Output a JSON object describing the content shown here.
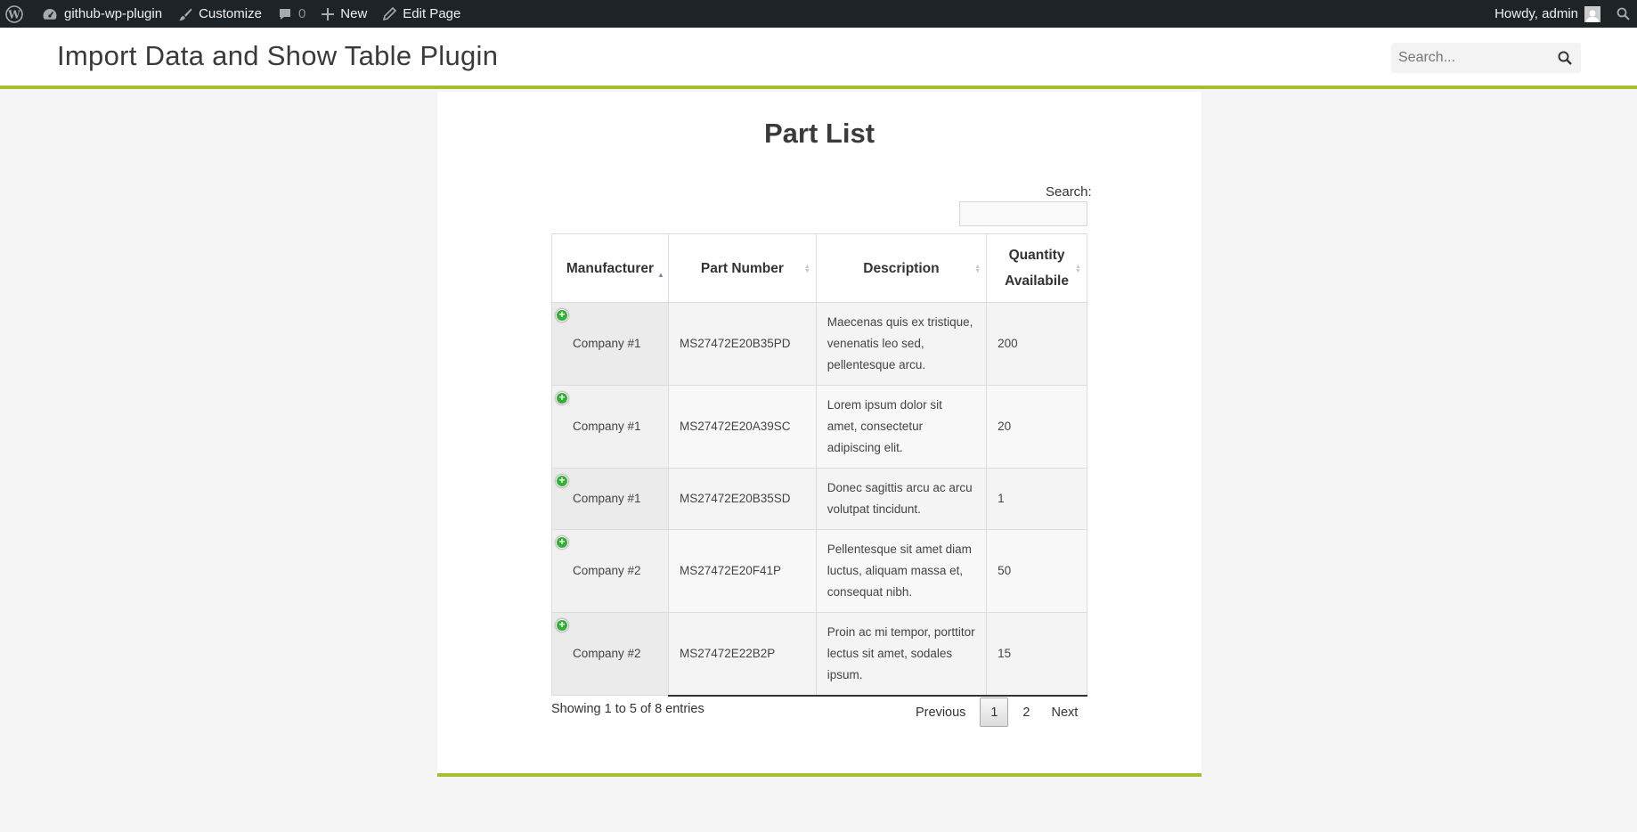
{
  "admin_bar": {
    "site_name": "github-wp-plugin",
    "customize": "Customize",
    "comments_count": "0",
    "new": "New",
    "edit_page": "Edit Page",
    "howdy": "Howdy, admin"
  },
  "header": {
    "site_title": "Import Data and Show Table Plugin",
    "search_placeholder": "Search..."
  },
  "page": {
    "title": "Part List",
    "search_label": "Search:"
  },
  "table": {
    "columns": [
      {
        "label": "Manufacturer",
        "sorted": "asc"
      },
      {
        "label": "Part Number"
      },
      {
        "label": "Description"
      },
      {
        "label": "Quantity Availabile"
      }
    ],
    "rows": [
      {
        "manufacturer": "Company #1",
        "part_number": "MS27472E20B35PD",
        "description": "Maecenas quis ex tristique, venenatis leo sed, pellentesque arcu.",
        "quantity": "200"
      },
      {
        "manufacturer": "Company #1",
        "part_number": "MS27472E20A39SC",
        "description": "Lorem ipsum dolor sit amet, consectetur adipiscing elit.",
        "quantity": "20"
      },
      {
        "manufacturer": "Company #1",
        "part_number": "MS27472E20B35SD",
        "description": "Donec sagittis arcu ac arcu volutpat tincidunt.",
        "quantity": "1"
      },
      {
        "manufacturer": "Company #2",
        "part_number": "MS27472E20F41P",
        "description": "Pellentesque sit amet diam luctus, aliquam massa et, consequat nibh.",
        "quantity": "50"
      },
      {
        "manufacturer": "Company #2",
        "part_number": "MS27472E22B2P",
        "description": "Proin ac mi tempor, porttitor lectus sit amet, sodales ipsum.",
        "quantity": "15"
      }
    ]
  },
  "pagination": {
    "info": "Showing 1 to 5 of 8 entries",
    "previous": "Previous",
    "pages": [
      "1",
      "2"
    ],
    "current_page": "1",
    "next": "Next"
  },
  "colors": {
    "admin_bar_bg": "#1d2327",
    "accent": "#a6bd2c",
    "expand_button": "#31b131"
  }
}
